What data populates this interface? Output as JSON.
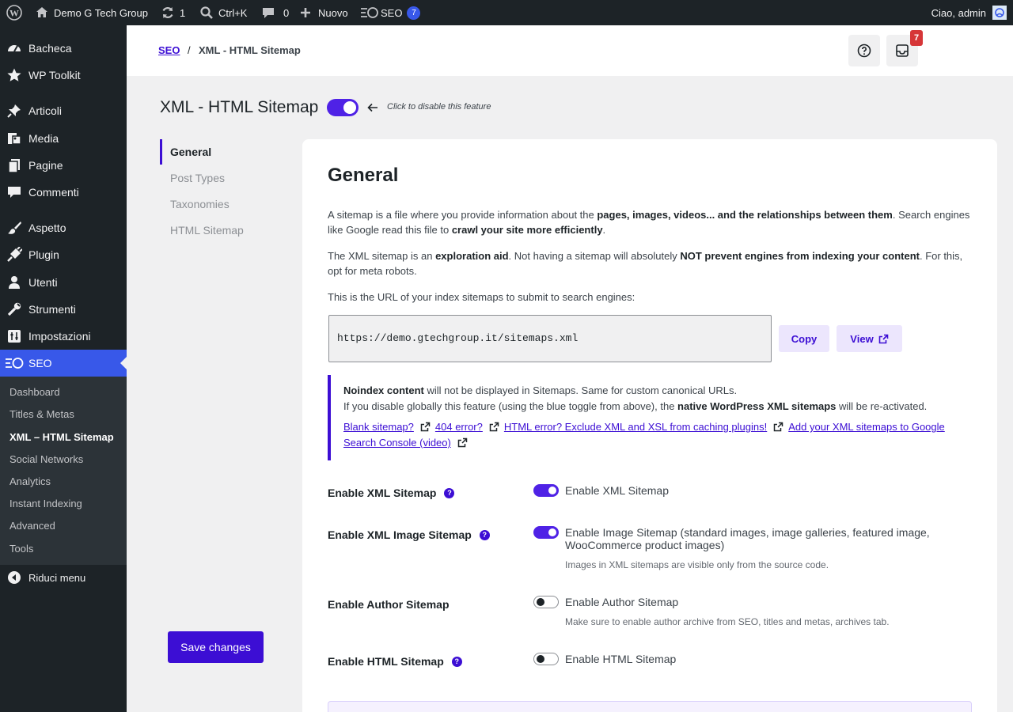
{
  "admin_bar": {
    "site_name": "Demo G Tech Group",
    "updates_count": "1",
    "search_shortcut": "Ctrl+K",
    "comments_count": "0",
    "new_label": "Nuovo",
    "seo_label": "SEO",
    "seo_badge": "7",
    "greeting": "Ciao, admin"
  },
  "sidebar": {
    "items": [
      {
        "label": "Bacheca",
        "icon": "dashboard-icon"
      },
      {
        "label": "WP Toolkit",
        "icon": "star-icon"
      },
      {
        "label": "Articoli",
        "icon": "pin-icon"
      },
      {
        "label": "Media",
        "icon": "media-icon"
      },
      {
        "label": "Pagine",
        "icon": "pages-icon"
      },
      {
        "label": "Commenti",
        "icon": "comment-icon"
      },
      {
        "label": "Aspetto",
        "icon": "brush-icon"
      },
      {
        "label": "Plugin",
        "icon": "plugin-icon"
      },
      {
        "label": "Utenti",
        "icon": "user-icon"
      },
      {
        "label": "Strumenti",
        "icon": "wrench-icon"
      },
      {
        "label": "Impostazioni",
        "icon": "settings-icon"
      },
      {
        "label": "SEO",
        "icon": "seo-icon"
      }
    ],
    "submenu": [
      "Dashboard",
      "Titles & Metas",
      "XML – HTML Sitemap",
      "Social Networks",
      "Analytics",
      "Instant Indexing",
      "Advanced",
      "Tools"
    ],
    "collapse_label": "Riduci menu"
  },
  "topbar": {
    "crumb_root": "SEO",
    "crumb_sep": "/",
    "crumb_current": "XML - HTML Sitemap",
    "notifications_count": "7"
  },
  "page": {
    "title": "XML - HTML Sitemap",
    "feature_enabled": true,
    "toggle_hint": "Click to disable this feature"
  },
  "subnav": [
    "General",
    "Post Types",
    "Taxonomies",
    "HTML Sitemap"
  ],
  "save_label": "Save changes",
  "general": {
    "title": "General",
    "p1": {
      "a": "A sitemap is a file where you provide information about the ",
      "b": "pages, images, videos... and the relationships between them",
      "c": ". Search engines like Google read this file to ",
      "d": "crawl your site more efficiently",
      "e": "."
    },
    "p2": {
      "a": "The XML sitemap is an ",
      "b": "exploration aid",
      "c": ". Not having a sitemap will absolutely ",
      "d": "NOT prevent engines from indexing your content",
      "e": ". For this, opt for meta robots."
    },
    "p3": "This is the URL of your index sitemaps to submit to search engines:",
    "sitemap_url": "https://demo.gtechgroup.it/sitemaps.xml",
    "copy_label": "Copy",
    "view_label": "View"
  },
  "notice": {
    "l1_bold": "Noindex content",
    "l1_rest": " will not be displayed in Sitemaps. Same for custom canonical URLs.",
    "l2_a": "If you disable globally this feature (using the blue toggle from above), the ",
    "l2_bold": "native WordPress XML sitemaps",
    "l2_c": " will be re-activated.",
    "links": [
      "Blank sitemap?",
      "404 error?",
      "HTML error? Exclude XML and XSL from caching plugins!",
      "Add your XML sitemaps to Google Search Console (video)"
    ]
  },
  "options": [
    {
      "label": "Enable XML Sitemap",
      "help": true,
      "enabled": true,
      "text": "Enable XML Sitemap",
      "desc": ""
    },
    {
      "label": "Enable XML Image Sitemap",
      "help": true,
      "enabled": true,
      "text": "Enable Image Sitemap (standard images, image galleries, featured image, WooCommerce product images)",
      "desc": "Images in XML sitemaps are visible only from the source code."
    },
    {
      "label": "Enable Author Sitemap",
      "help": false,
      "enabled": false,
      "text": "Enable Author Sitemap",
      "desc": "Make sure to enable author archive from SEO, titles and metas, archives tab."
    },
    {
      "label": "Enable HTML Sitemap",
      "help": true,
      "enabled": false,
      "text": "Enable HTML Sitemap",
      "desc": ""
    }
  ],
  "colors": {
    "accent": "#3c0ed4",
    "toggle_on": "#4f22e6",
    "wp_blue": "#3858e9",
    "sidebar_bg": "#1d2327"
  }
}
